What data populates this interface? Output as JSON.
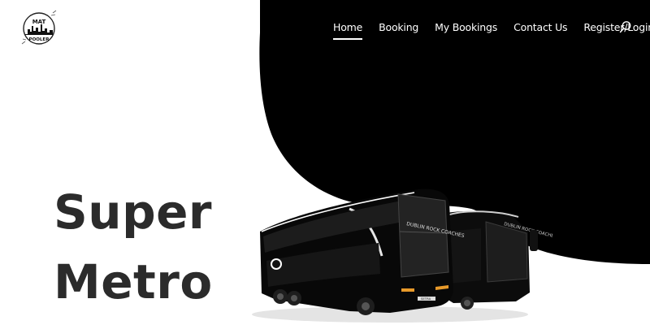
{
  "nav": {
    "items": [
      {
        "label": "Home",
        "active": true
      },
      {
        "label": "Booking",
        "active": false
      },
      {
        "label": "My Bookings",
        "active": false
      },
      {
        "label": "Contact Us",
        "active": false
      },
      {
        "label": "Register/Login",
        "active": false,
        "has_dropdown": true
      }
    ],
    "search_icon": "search-icon"
  },
  "logo": {
    "line1": "MAT",
    "line2": "POOLER"
  },
  "hero": {
    "title_line1": "Super",
    "title_line2": "Metro"
  },
  "bus": {
    "side_text": "DUBLIN ROCK COACHES",
    "front_text": "SETRA"
  },
  "colors": {
    "blob": "#000000",
    "background": "#ffffff",
    "title": "#2b2b2b",
    "nav_text": "#ffffff"
  }
}
